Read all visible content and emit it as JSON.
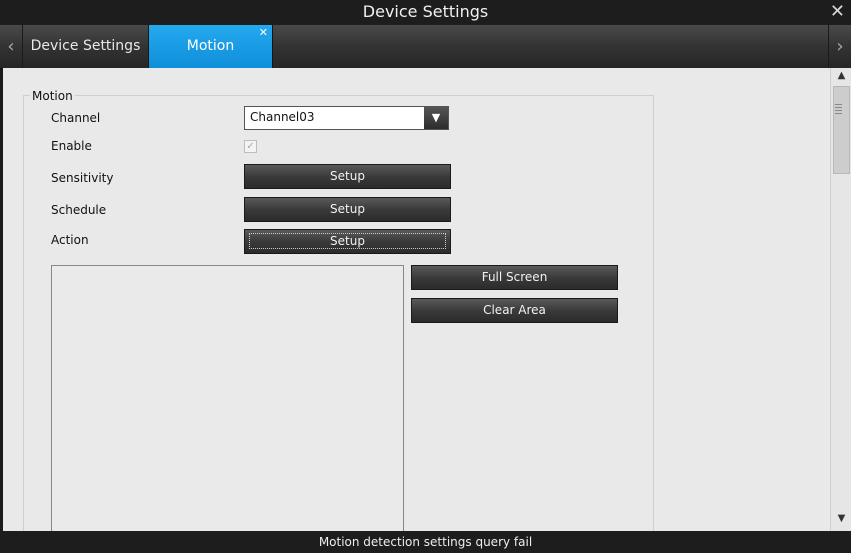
{
  "window": {
    "title": "Device Settings"
  },
  "tabs": [
    {
      "label": "Device Settings",
      "active": false
    },
    {
      "label": "Motion",
      "active": true
    }
  ],
  "colors": {
    "accent": "#1aa0e6",
    "chrome": "#1d1d1d",
    "panel": "#e9e9e9"
  },
  "motion": {
    "group_label": "Motion",
    "channel_label": "Channel",
    "channel_value": "Channel03",
    "enable_label": "Enable",
    "enable_checked": true,
    "sensitivity_label": "Sensitivity",
    "schedule_label": "Schedule",
    "action_label": "Action",
    "setup_label": "Setup",
    "full_screen_label": "Full Screen",
    "clear_area_label": "Clear Area"
  },
  "status": {
    "message": "Motion detection settings query fail"
  }
}
